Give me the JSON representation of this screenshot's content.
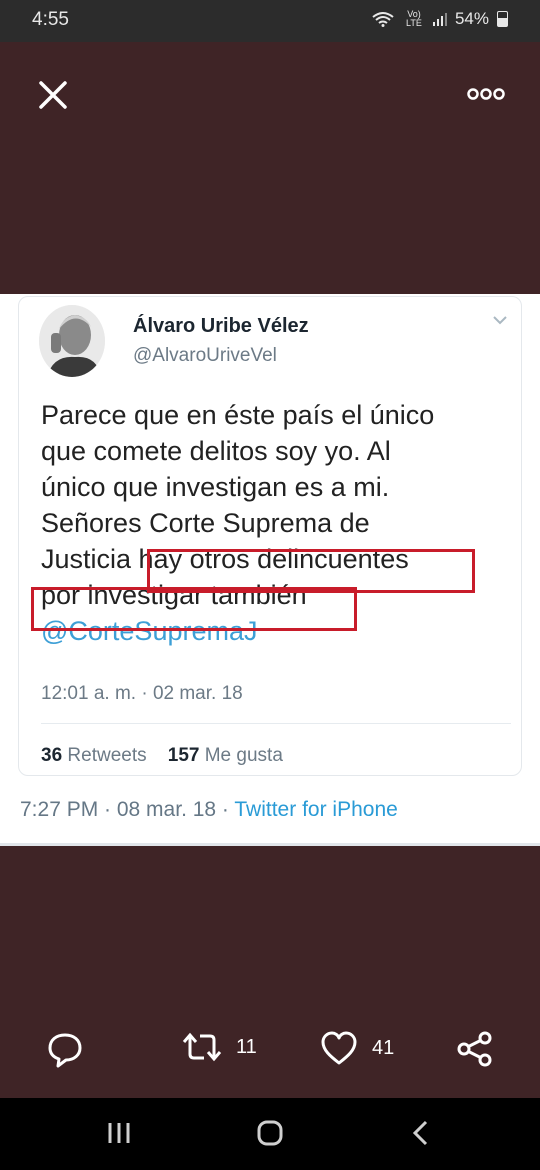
{
  "status_bar": {
    "time": "4:55",
    "network": "Vo) LTE",
    "battery": "54%"
  },
  "top_bar": {
    "close_icon": "close-icon",
    "more_icon": "more-horizontal-icon"
  },
  "tweet": {
    "author_name": "Álvaro Uribe Vélez",
    "author_handle": "@AlvaroUriveVel",
    "text_lines": [
      "Parece que en éste país el único",
      "que comete delitos soy yo. Al",
      "único que investigan es a mi.",
      "Señores Corte Suprema de",
      "Justicia hay otros delincuentes",
      "por investigar también",
      "@CorteSupremaJ"
    ],
    "date": "12:01 a. m. · 02 mar. 18",
    "retweets_count": "36",
    "retweets_label": "Retweets",
    "likes_count": "157",
    "likes_label": "Me gusta"
  },
  "post_meta": {
    "timestamp": "7:27 PM · 08 mar. 18 · ",
    "source": "Twitter for iPhone"
  },
  "actions": {
    "reply_icon": "comment-icon",
    "retweet_icon": "retweet-icon",
    "retweet_count": "11",
    "like_icon": "heart-icon",
    "like_count": "41",
    "share_icon": "share-icon"
  },
  "colors": {
    "background": "#3f2426",
    "highlight_box": "#c81c2a",
    "link": "#2a9bd6"
  }
}
